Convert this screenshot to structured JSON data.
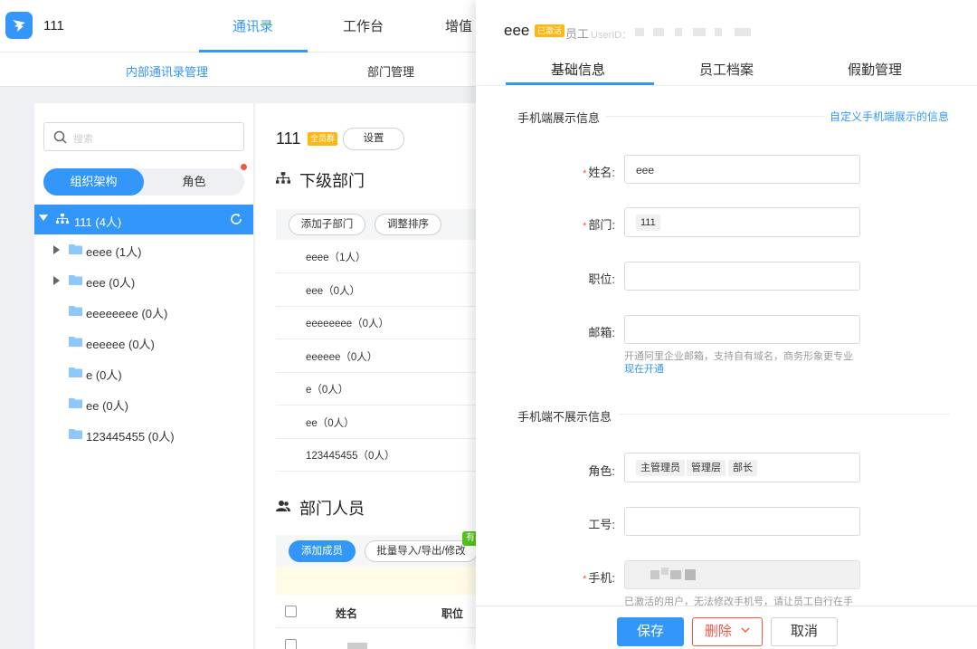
{
  "header": {
    "org_name": "111",
    "nav": [
      "通讯录",
      "工作台",
      "增值"
    ],
    "sub_nav": [
      "内部通讯录管理",
      "部门管理"
    ]
  },
  "sidebar": {
    "search_placeholder": "搜索",
    "seg_org": "组织架构",
    "seg_role": "角色",
    "root_label": "111 (4人)",
    "items": [
      {
        "label": "eeee (1人)",
        "expandable": true
      },
      {
        "label": "eee (0人)",
        "expandable": true
      },
      {
        "label": "eeeeeeee (0人)",
        "expandable": false
      },
      {
        "label": "eeeeee (0人)",
        "expandable": false
      },
      {
        "label": "e (0人)",
        "expandable": false
      },
      {
        "label": "ee (0人)",
        "expandable": false
      },
      {
        "label": "123445455 (0人)",
        "expandable": false
      }
    ]
  },
  "middle": {
    "dept_name": "111",
    "dept_tag": "全员群",
    "settings_btn": "设置",
    "sub_dept_title": "下级部门",
    "add_sub_btn": "添加子部门",
    "sort_btn": "调整排序",
    "sub_depts": [
      "eeee（1人）",
      "eee（0人）",
      "eeeeeeee（0人）",
      "eeeeee（0人）",
      "e（0人）",
      "ee（0人）",
      "123445455（0人）"
    ],
    "members_title": "部门人员",
    "add_member_btn": "添加成员",
    "import_btn": "批量导入/导出/修改",
    "badge": "有",
    "col_name": "姓名",
    "col_position": "职位"
  },
  "drawer": {
    "name": "eee",
    "status_tag": "已激活",
    "emp_label": "员工",
    "uid_label": "UserID：",
    "tabs": [
      "基础信息",
      "员工档案",
      "假勤管理"
    ],
    "group_visible": "手机端展示信息",
    "customize_link": "自定义手机端展示的信息",
    "group_hidden": "手机端不展示信息",
    "fields": {
      "name_label": "姓名:",
      "name_value": "eee",
      "dept_label": "部门:",
      "dept_value": "111",
      "position_label": "职位:",
      "email_label": "邮箱:",
      "email_hint": "开通阿里企业邮箱，支持自有域名，商务形象更专业",
      "email_link": "现在开通",
      "role_label": "角色:",
      "roles": [
        "主管理员",
        "管理层",
        "部长"
      ],
      "jobno_label": "工号:",
      "phone_label": "手机:",
      "phone_hint": "已激活的用户，无法修改手机号，请让员工自行在手"
    },
    "footer": {
      "save": "保存",
      "delete": "删除",
      "cancel": "取消"
    }
  },
  "colors": {
    "primary": "#3296fa",
    "danger": "#f25643",
    "tag": "#ffb70f"
  }
}
